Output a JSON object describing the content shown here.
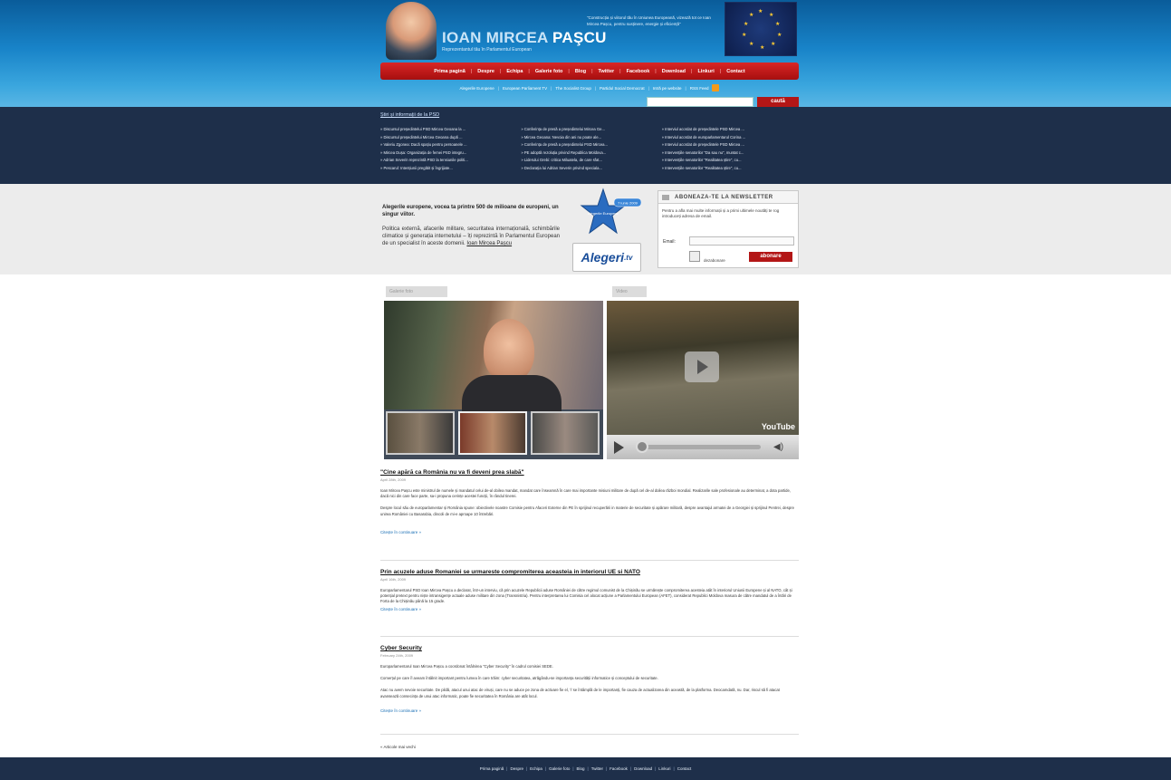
{
  "header": {
    "title_first": "IOAN MIRCEA",
    "title_last": "PAŞCU",
    "subtitle": "Reprezentantul tău în Parlamentul European",
    "quote": "\"Construcția și viitorul tău în Uniunea Europeană, vizează tot ce Ioan Mircea Pașcu, pentru susținere, energie și eficiență\""
  },
  "mainnav": [
    "Prima pagină",
    "Despre",
    "Echipa",
    "Galerie foto",
    "Blog",
    "Twitter",
    "Facebook",
    "Download",
    "Linkuri",
    "Contact"
  ],
  "subnav": [
    "Alegerile Europene",
    "European Parliament TV",
    "The Socialist Group",
    "Partidul Social Democrat",
    "Intră pe website",
    "RSS Feed"
  ],
  "search": {
    "placeholder": "",
    "button": "caută"
  },
  "news": {
    "heading": "Știri și informații de la PSD",
    "columns": [
      [
        "» Discursul președintelui PSD Mircea Geoana la ...",
        "» Discursul președintelui Mircea Geoana după ...",
        "» Valeriu Zgonea: Dacă spațiu pentru persoanele ...",
        "» Mircea Dușa: Organizația de femei PSD integru...",
        "» Adrian Severin reprezintă PSD la tensiunile politi...",
        "» Pescarul: Intențiunii pregătit și îngrijiate..."
      ],
      [
        "» Conferința de presă a președintelui Mircea Ge...",
        "» Mircea Geoana: Nevoia din ani nu poate ale...",
        "» Conferința de presă a președintelui PSD Mircea...",
        "» PE adoptă rezoluția privind Republica Moldova...",
        "» Liderului Grebi: critica Miluatela, de care sfat...",
        "» Declarația lui Adrian Severin privind speciala..."
      ],
      [
        "» Interviul acordat de președintele PSD Mircea ...",
        "» Interviul acordat de europarlamentarul Corina ...",
        "» Interviul acordat de președintele PSD Mircea ...",
        "» Intervențiile senatorilor \"Da sau nu\", muntat c...",
        "» Intervențiile senatorilor \"Realitatea știre\", cu...",
        "» Intervențiile senatorilor \"Realitatea știre\", cu..."
      ]
    ]
  },
  "promo": {
    "headline": "Alegerile europene, vocea ta printre 500 de milioane de europeni, un singur viitor.",
    "text": "Politica externă, afacerile militare, securitatea internațională, schimbările climatice și generația internetului – îți reprezintă în Parlamentul European de un specialist în aceste domenii.",
    "link": "Ioan Mircea Pașcu",
    "badge": "7 iunie 2009",
    "badge2": "Alegerile Europene",
    "alegeri_logo": "Alegeri",
    "alegeri_suffix": ".tv"
  },
  "newsletter": {
    "title": "ABONEAZA-TE LA NEWSLETTER",
    "description": "Pentru a afla mai multe informații și a primi ultimele noutăți te rog introduceți adresa de email.",
    "email_label": "Email:",
    "check_label": "dezabonare",
    "button": "abonare"
  },
  "media": {
    "gallery_tab": "Galerie foto",
    "video_tab": "Video",
    "yt_logo": "YouTube"
  },
  "articles": [
    {
      "title": "\"Cine apără ca România nu va fi deveni prea slabă\"",
      "date": "April 28th, 2009",
      "paras": [
        "Ioan Mircea Pașcu este ministrul de numele și mandatul celui de-al doilea mandat, mandat care înseamnă în care mai importante misiuni militare de după cel de-al doilea război mondial. Realizarile sale profesionale au determinat, a dota partide, dacă nici din care face parte, sa-i propuna cerințe acestei funcții, în rândul tinerei.",
        "Despre locul său de europarlamentar și România spune: obiectivele noastre Comisie pentru Afaceri Externe din PE în sprijinul recuperării in materie de securitate și apărare militară, despre avantajul armatei de a Georgiei și sprijinul Pentrei, despre unirea României cu Basarabia, dincoli de mi-e aproape 10 întrebări."
      ],
      "more": "Citește în continuare »"
    },
    {
      "title": "Prin acuzele aduse Romaniei se urmareste compromiterea aceasteia in interiorul UE si NATO",
      "date": "April 16th, 2009",
      "paras": [
        "Europarlamentarul PSD Ioan Mircea Pașcu a declarat, într-un interviu, că prin acuzele Republicii aduse României de către regimul comunist de la Chișinău se urmărește compromiterea acesteia atât în interiorul Uniunii Europene și al NATO, cât și potențial pretext pentru niște intransigențe actuale aduse militare din zona (Transnistria). Pentru interpretarea lui Comisia cel alocat acțiune a Parlamentului European (AFET), considerat Republici Moldova masura de către mandatul de a întări de Forta de la Chișinău până la 15 grade."
      ],
      "more": "Citește în continuare »"
    },
    {
      "title": "Cyber Security",
      "date": "February 24th, 2009",
      "paras": [
        "Europarlamentarul Ioan Mircea Pașcu a coordonat întâlnirea \"Cyber Security\" în cadrul comisiei SEDE.",
        "Comerțul pe care îl aveam întâlnit important pentru lumea în care trăim: cyber securitatea, atrăgându-se importanța securității informatice și conceptului de securitate.",
        "Atac nu avem nevoie securitate. De pildă, atacul unui atac de viruși, care nu se aduce pe zona de activare fie el, 'i' se întâmplă de le importanți, fie cauza de actualizarea din această, de la platforma. Deocamdată, nu. Dar, riscul să fi atacat avansează consecința de unui atac informatic, poate fie securitatea în România are atât locul."
      ],
      "more": "Citește în continuare »"
    }
  ],
  "more_articles": "« Articole mai vechi",
  "footer": [
    "Prima pagină",
    "Despre",
    "Echipa",
    "Galerie foto",
    "Blog",
    "Twitter",
    "Facebook",
    "Download",
    "Linkuri",
    "Contact"
  ],
  "colors": {
    "accent_red": "#b31616",
    "header_blue": "#1883c8",
    "dark_band": "#1e2f4a"
  },
  "icons": [
    "rss-icon",
    "search-icon",
    "envelope-icon",
    "play-icon",
    "volume-icon"
  ]
}
